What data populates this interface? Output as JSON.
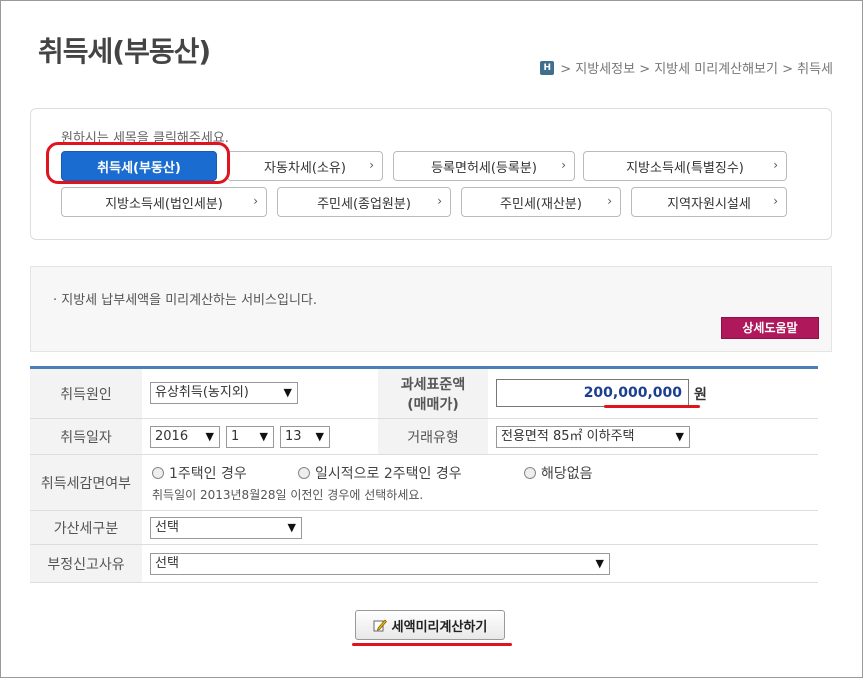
{
  "page": {
    "title": "취득세(부동산)"
  },
  "breadcrumb": {
    "home_icon": "H",
    "path": "> 지방세정보 > 지방세 미리계산해보기 > 취득세"
  },
  "tax_selector": {
    "prompt": "원하시는 세목을 클릭해주세요.",
    "chevron": "›",
    "items": [
      "취득세(부동산)",
      "자동차세(소유)",
      "등록면허세(등록분)",
      "지방소득세(특별징수)",
      "지방소득세(법인세분)",
      "주민세(종업원분)",
      "주민세(재산분)",
      "지역자원시설세"
    ]
  },
  "info": {
    "text": "· 지방세 납부세액을 미리계산하는 서비스입니다.",
    "help_button": "상세도움말"
  },
  "form": {
    "acquisition_cause": {
      "label": "취득원인",
      "value": "유상취득(농지외)"
    },
    "tax_base": {
      "label_line1": "과세표준액",
      "label_line2": "(매매가)",
      "value": "200,000,000",
      "unit": "원"
    },
    "acquisition_date": {
      "label": "취득일자",
      "year": "2016",
      "month": "1",
      "day": "13"
    },
    "transaction_type": {
      "label": "거래유형",
      "value": "전용면적 85㎡ 이하주택"
    },
    "reduction": {
      "label": "취득세감면여부",
      "options": [
        "1주택인 경우",
        "일시적으로 2주택인 경우",
        "해당없음"
      ],
      "note": "취득일이 2013년8월28일 이전인 경우에 선택하세요."
    },
    "surcharge": {
      "label": "가산세구분",
      "value": "선택"
    },
    "improper_reason": {
      "label": "부정신고사유",
      "value": "선택"
    }
  },
  "dropdown_arrow": "▼",
  "calc_button": {
    "label": "세액미리계산하기"
  },
  "colors": {
    "active": "#1a6cd0",
    "help": "#b0185c",
    "highlight": "#e0141e",
    "form_border": "#4a7fb8"
  }
}
